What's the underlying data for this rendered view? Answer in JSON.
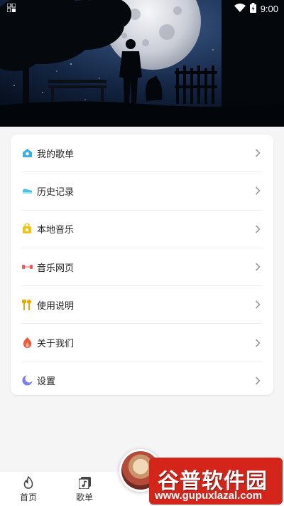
{
  "status": {
    "time": "9:00",
    "left_icon": "notification-icon",
    "wifi_icon": "wifi-icon",
    "battery_icon": "battery-charging-icon"
  },
  "hero": {
    "image": "night-scene-moon-man-dog"
  },
  "menu": {
    "items": [
      {
        "label": "我的歌单",
        "icon": "playlist-icon",
        "color": "#3bb0e8"
      },
      {
        "label": "历史记录",
        "icon": "history-icon",
        "color": "#4cc1e6"
      },
      {
        "label": "本地音乐",
        "icon": "local-music-icon",
        "color": "#f4c20d"
      },
      {
        "label": "音乐网页",
        "icon": "web-music-icon",
        "color": "#f15a5a"
      },
      {
        "label": "使用说明",
        "icon": "instructions-icon",
        "color": "#f0a500"
      },
      {
        "label": "关于我们",
        "icon": "about-icon",
        "color": "#f25a3a"
      },
      {
        "label": "设置",
        "icon": "settings-icon",
        "color": "#7b7cf0"
      }
    ]
  },
  "nav": {
    "home_label": "首页",
    "playlist_label": "歌单"
  },
  "watermark": {
    "title": "谷普软件园",
    "url": "www.gupuxlazal.com"
  }
}
